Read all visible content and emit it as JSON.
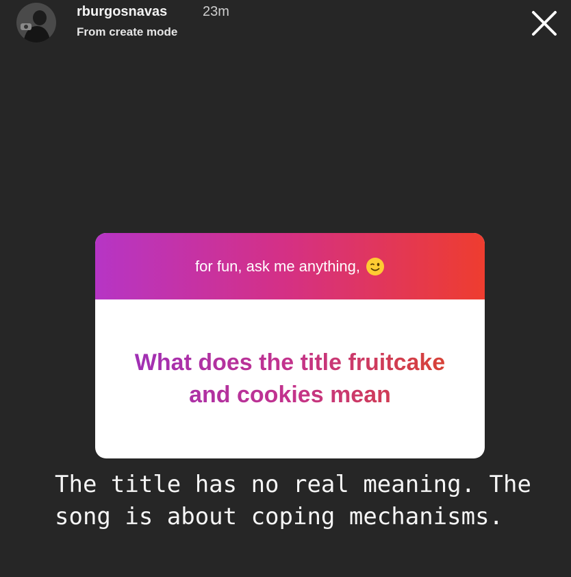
{
  "story": {
    "username": "rburgosnavas",
    "time": "23m",
    "subtitle": "From create mode"
  },
  "question_sticker": {
    "prompt": "for fun, ask me anything,",
    "prompt_emoji": "winking-face-icon",
    "question": "What does the title fruitcake and cookies mean"
  },
  "answer": {
    "text": "The title has no real meaning. The song is about coping mechanisms."
  },
  "colors": {
    "background": "#262626",
    "gradient_start": "#b635c5",
    "gradient_mid": "#d43086",
    "gradient_end": "#ee3d2f"
  }
}
